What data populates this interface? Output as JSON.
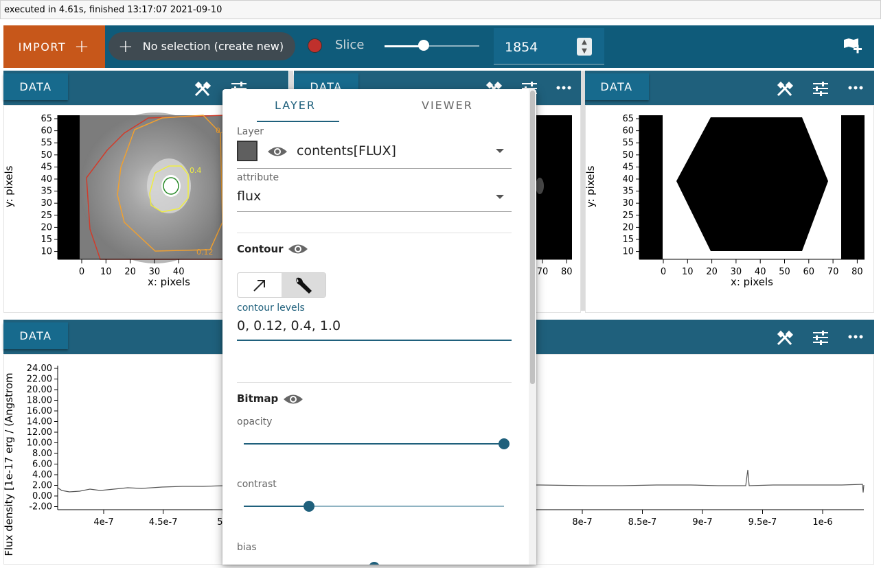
{
  "exec_status": "executed in 4.61s, finished 13:17:07 2021-09-10",
  "toolbar": {
    "import_label": "IMPORT",
    "subset_label": "No selection (create new)",
    "slice_label": "Slice",
    "slice_value": "1854",
    "slice_slider_fraction": 0.41,
    "slice_color": "#c0302c"
  },
  "viewers": {
    "data_label": "DATA",
    "image1": {
      "y_label": "y: pixels",
      "x_label": "x: pixels",
      "y_ticks": [
        "65",
        "60",
        "55",
        "50",
        "45",
        "40",
        "35",
        "30",
        "25",
        "20",
        "15",
        "10"
      ],
      "x_ticks": [
        "0",
        "10",
        "20",
        "30",
        "40"
      ],
      "contour_labels": [
        "0.12",
        "0.4",
        "0.12"
      ]
    },
    "image2": {
      "x_ticks": [
        "70",
        "80"
      ]
    },
    "image3": {
      "y_label": "y: pixels",
      "x_label": "x: pixels",
      "y_ticks": [
        "65",
        "60",
        "55",
        "50",
        "45",
        "40",
        "35",
        "30",
        "25",
        "20",
        "15",
        "10"
      ],
      "x_ticks": [
        "0",
        "10",
        "20",
        "30",
        "40",
        "50",
        "60",
        "70",
        "80"
      ]
    },
    "spectrum": {
      "y_label": "Flux density [1e-17 erg / (Angstrom",
      "y_ticks": [
        "24.00",
        "22.00",
        "20.00",
        "18.00",
        "16.00",
        "14.00",
        "12.00",
        "10.00",
        "8.00",
        "6.00",
        "4.00",
        "2.00",
        "0.00",
        "-2.00"
      ],
      "x_ticks_left": [
        "4e-7",
        "4.5e-7",
        "5e"
      ],
      "x_ticks_right": [
        "8e-7",
        "8.5e-7",
        "9e-7",
        "9.5e-7",
        "1e-6"
      ]
    }
  },
  "layer_panel": {
    "tab_layer": "LAYER",
    "tab_viewer": "VIEWER",
    "layer_label": "Layer",
    "layer_value": "contents[FLUX]",
    "attribute_label": "attribute",
    "attribute_value": "flux",
    "contour_title": "Contour",
    "contour_levels_label": "contour levels",
    "contour_levels_value": "0, 0.12, 0.4, 1.0",
    "bitmap_title": "Bitmap",
    "opacity_label": "opacity",
    "opacity_value": 1.0,
    "contrast_label": "contrast",
    "contrast_value": 0.25,
    "bias_label": "bias",
    "layer_color": "#5f5f5f"
  },
  "colors": {
    "toolbar_bg": "#0f5b7a",
    "import_bg": "#c7571a",
    "viewer_bar": "#1f607c",
    "accent": "#1f607c"
  }
}
